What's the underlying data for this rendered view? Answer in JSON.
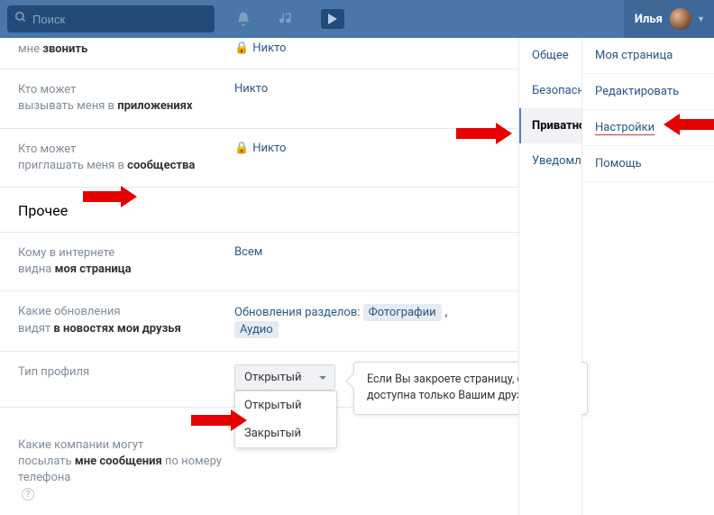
{
  "header": {
    "search_placeholder": "Поиск",
    "username": "Илья"
  },
  "rows": {
    "call": {
      "label_pre": "мне ",
      "label_bold": "звонить",
      "value": "Никто"
    },
    "apps": {
      "label_pre": "Кто может\nвызывать меня в ",
      "label_bold": "приложениях",
      "value": "Никто"
    },
    "communities": {
      "label_pre": "Кто может\nприглашать меня в ",
      "label_bold": "сообщества",
      "value": "Никто"
    },
    "section_other": "Прочее",
    "internet": {
      "label_pre": "Кому в интернете\nвидна ",
      "label_bold": "моя страница",
      "value": "Всем"
    },
    "news": {
      "label_pre": "Какие обновления\nвидят ",
      "label_bold": "в новостях мои друзья",
      "prefix": "Обновления разделов: ",
      "chip1": "Фотографии",
      "chip2": "Аудио"
    },
    "profile_type": {
      "label": "Тип профиля",
      "selected": "Открытый"
    },
    "companies": {
      "label_pre": "Какие компании могут\nпосылать ",
      "label_bold": "мне сообщения",
      "label_post": " по номеру\nтелефона"
    }
  },
  "profile_options": {
    "open": "Открытый",
    "closed": "Закрытый"
  },
  "tooltip_text": "Если Вы закроете страницу, она будет доступна только Вашим друзьям.",
  "tabs": {
    "general": "Общее",
    "security": "Безопасность",
    "privacy": "Приватность",
    "notifications": "Уведомления"
  },
  "dropdown": {
    "my_page": "Моя страница",
    "edit": "Редактировать",
    "settings": "Настройки",
    "help": "Помощь"
  }
}
